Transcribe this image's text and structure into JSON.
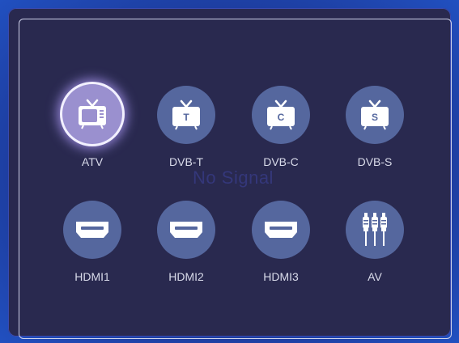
{
  "watermark": "No Signal",
  "sources": [
    {
      "label": "ATV",
      "icon": "tv-icon",
      "letter": "",
      "focused": true
    },
    {
      "label": "DVB-T",
      "icon": "tv-icon",
      "letter": "T",
      "focused": false
    },
    {
      "label": "DVB-C",
      "icon": "tv-icon",
      "letter": "C",
      "focused": false
    },
    {
      "label": "DVB-S",
      "icon": "tv-icon",
      "letter": "S",
      "focused": false
    },
    {
      "label": "HDMI1",
      "icon": "hdmi-icon",
      "focused": false
    },
    {
      "label": "HDMI2",
      "icon": "hdmi-icon",
      "focused": false
    },
    {
      "label": "HDMI3",
      "icon": "hdmi-icon",
      "focused": false
    },
    {
      "label": "AV",
      "icon": "av-plugs-icon",
      "focused": false
    }
  ],
  "colors": {
    "panel": "#29294f",
    "circle": "#55679e",
    "focus": "#9a90cf",
    "label": "#d9dbea"
  }
}
